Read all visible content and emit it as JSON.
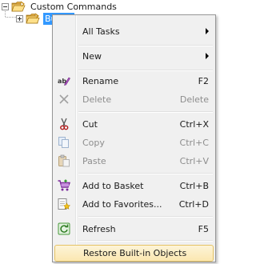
{
  "tree": {
    "root_label": "Custom Commands",
    "child_label": "Builtin"
  },
  "menu": {
    "items": [
      {
        "label": "All Tasks",
        "shortcut": "",
        "submenu": true,
        "disabled": false,
        "icon": ""
      },
      {
        "label": "New",
        "shortcut": "",
        "submenu": true,
        "disabled": false,
        "icon": ""
      },
      {
        "label": "Rename",
        "shortcut": "F2",
        "disabled": false,
        "icon": "rename-icon"
      },
      {
        "label": "Delete",
        "shortcut": "Delete",
        "disabled": true,
        "icon": "delete-icon"
      },
      {
        "label": "Cut",
        "shortcut": "Ctrl+X",
        "disabled": false,
        "icon": "scissors-icon"
      },
      {
        "label": "Copy",
        "shortcut": "Ctrl+C",
        "disabled": true,
        "icon": "copy-icon"
      },
      {
        "label": "Paste",
        "shortcut": "Ctrl+V",
        "disabled": true,
        "icon": "paste-icon"
      },
      {
        "label": "Add to Basket",
        "shortcut": "Ctrl+B",
        "disabled": false,
        "icon": "basket-icon"
      },
      {
        "label": "Add to Favorites...",
        "shortcut": "Ctrl+D",
        "disabled": false,
        "icon": "favorites-icon"
      },
      {
        "label": "Refresh",
        "shortcut": "F5",
        "disabled": false,
        "icon": "refresh-icon"
      },
      {
        "label": "Restore Built-in Objects",
        "shortcut": "",
        "disabled": false,
        "highlighted": true,
        "icon": ""
      }
    ]
  },
  "colors": {
    "selection": "#3399ff",
    "menu_background": "#f0f0f0",
    "highlight_border": "#e5c365",
    "disabled_text": "#8d8d8d"
  }
}
